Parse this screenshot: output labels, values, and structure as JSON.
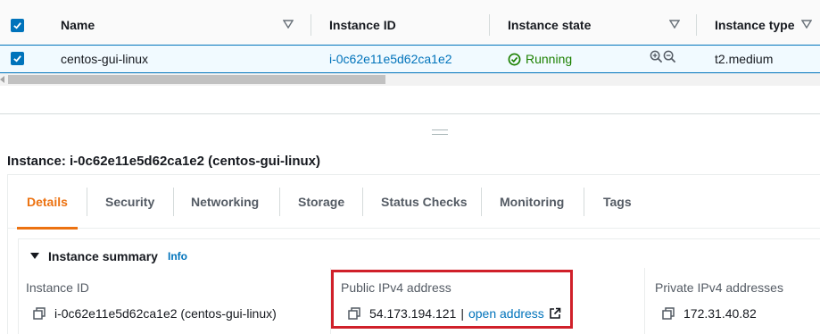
{
  "table": {
    "columns": [
      {
        "label": "Name",
        "sortable": true
      },
      {
        "label": "Instance ID",
        "sortable": false
      },
      {
        "label": "Instance state",
        "sortable": true
      },
      {
        "label": "Instance type",
        "sortable": true
      }
    ],
    "rows": [
      {
        "selected": true,
        "name": "centos-gui-linux",
        "instance_id": "i-0c62e11e5d62ca1e2",
        "state": "Running",
        "type": "t2.medium"
      }
    ]
  },
  "detail": {
    "title": "Instance: i-0c62e11e5d62ca1e2 (centos-gui-linux)",
    "tabs": [
      {
        "label": "Details",
        "active": true
      },
      {
        "label": "Security",
        "active": false
      },
      {
        "label": "Networking",
        "active": false
      },
      {
        "label": "Storage",
        "active": false
      },
      {
        "label": "Status Checks",
        "active": false
      },
      {
        "label": "Monitoring",
        "active": false
      },
      {
        "label": "Tags",
        "active": false
      }
    ],
    "summary": {
      "title": "Instance summary",
      "info_label": "Info",
      "fields": [
        {
          "label": "Instance ID",
          "value": "i-0c62e11e5d62ca1e2 (centos-gui-linux)"
        },
        {
          "label": "Public IPv4 address",
          "value": "54.173.194.121",
          "separator": "|",
          "link": "open address"
        },
        {
          "label": "Private IPv4 addresses",
          "value": "172.31.40.82"
        }
      ]
    }
  },
  "colors": {
    "accent": "#0073bb",
    "active_tab": "#ec7211",
    "running": "#1d8102",
    "highlight": "#d0202a"
  }
}
